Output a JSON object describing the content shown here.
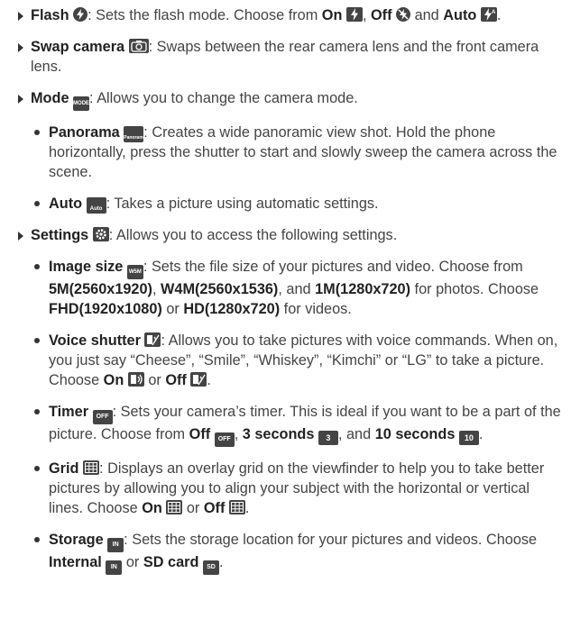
{
  "items": [
    {
      "name": "flash",
      "level": 1,
      "label": "Flash",
      "text1": ": Sets the flash mode. Choose from ",
      "opt1": "On",
      "sep1": ", ",
      "opt2": "Off",
      "sep2": " and ",
      "opt3": "Auto",
      "end": "."
    },
    {
      "name": "swap-camera",
      "level": 1,
      "label": "Swap camera",
      "text1": ": Swaps between the rear camera lens and the front camera lens."
    },
    {
      "name": "mode",
      "level": 1,
      "label": "Mode",
      "icon_text": "MODE",
      "text1": ": Allows you to change the camera mode."
    },
    {
      "name": "panorama",
      "level": 2,
      "label": "Panorama",
      "icon_text": "Panorama",
      "text1": ": Creates a wide panoramic view shot. Hold the phone horizontally, press the shutter to start and slowly sweep the camera across the scene."
    },
    {
      "name": "auto",
      "level": 2,
      "label": "Auto",
      "icon_text": "Auto",
      "text1": ": Takes a picture using automatic settings."
    },
    {
      "name": "settings",
      "level": 1,
      "label": "Settings",
      "text1": ": Allows you to access the following settings."
    },
    {
      "name": "image-size",
      "level": 2,
      "label": "Image size",
      "icon_text": "W5M",
      "text1": ": Sets the file size of your pictures and video. Choose from ",
      "opt1": "5M(2560x1920)",
      "sep1": ", ",
      "opt2": "W4M(2560x1536)",
      "sep2": ", and ",
      "opt3": "1M(1280x720)",
      "sep3": " for photos. Choose ",
      "opt4": "FHD(1920x1080)",
      "sep4": " or ",
      "opt5": "HD(1280x720)",
      "end": " for videos."
    },
    {
      "name": "voice-shutter",
      "level": 2,
      "label": "Voice shutter",
      "text1": ": Allows you to take pictures with voice commands. When on, you just say “Cheese”, “Smile”, “Whiskey”, “Kimchi” or “LG” to take a picture. Choose ",
      "opt1": "On",
      "sep1": " or ",
      "opt2": "Off",
      "end": "."
    },
    {
      "name": "timer",
      "level": 2,
      "label": "Timer",
      "icon_text": "OFF",
      "text1": ": Sets your camera’s timer. This is ideal if you want to be a part of the picture. Choose from ",
      "opt1": "Off",
      "icon1": "OFF",
      "sep1": ", ",
      "opt2": "3 seconds",
      "icon2": "3",
      "sep2": ", and ",
      "opt3": "10 seconds",
      "icon3": "10",
      "end": "."
    },
    {
      "name": "grid",
      "level": 2,
      "label": "Grid",
      "text1": ": Displays an overlay grid on the viewfinder to help you to take better pictures by allowing you to align your subject with the horizontal or vertical lines. Choose ",
      "opt1": "On",
      "sep1": " or ",
      "opt2": "Off",
      "end": "."
    },
    {
      "name": "storage",
      "level": 2,
      "label": "Storage",
      "icon_text": "IN",
      "text1": ": Sets the storage location for your pictures and videos. Choose ",
      "opt1": "Internal",
      "icon1": "IN",
      "sep1": " or ",
      "opt2": "SD card",
      "icon2": "SD",
      "end": "."
    }
  ]
}
